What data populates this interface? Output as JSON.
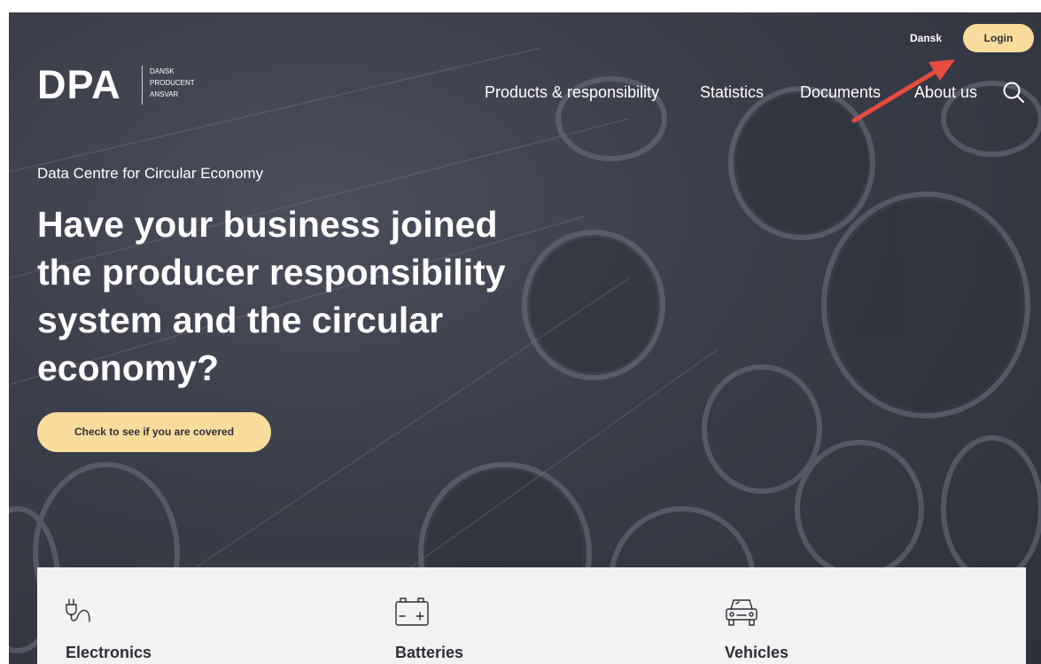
{
  "header": {
    "language_label": "Dansk",
    "login_label": "Login",
    "logo": {
      "mark": "DPA",
      "subtitle_lines": [
        "DANSK",
        "PRODUCENT",
        "ANSVAR"
      ]
    },
    "nav_items": [
      {
        "label": "Products & responsibility"
      },
      {
        "label": "Statistics"
      },
      {
        "label": "Documents"
      },
      {
        "label": "About us"
      }
    ],
    "search_icon": "search-icon"
  },
  "hero": {
    "eyebrow": "Data Centre for Circular Economy",
    "headline": "Have your business joined the producer responsibility system and the circular economy?",
    "cta_label": "Check to see if you are covered"
  },
  "categories": [
    {
      "label": "Electronics",
      "icon": "plug-icon"
    },
    {
      "label": "Batteries",
      "icon": "battery-icon"
    },
    {
      "label": "Vehicles",
      "icon": "car-icon"
    }
  ],
  "annotation": {
    "arrow_color": "#e74c3c"
  },
  "colors": {
    "accent": "#f9dc9c",
    "hero_bg": "#383a47",
    "card_bg": "#f2f2f2",
    "text_dark": "#2e2f3a"
  }
}
